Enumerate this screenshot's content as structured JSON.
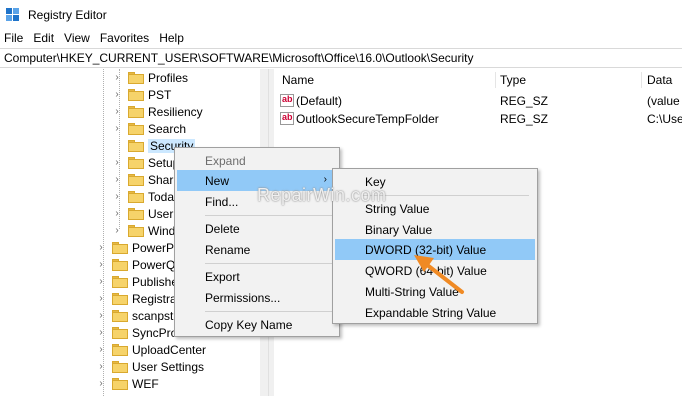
{
  "window": {
    "title": "Registry Editor"
  },
  "menu": [
    "File",
    "Edit",
    "View",
    "Favorites",
    "Help"
  ],
  "address": "Computer\\HKEY_CURRENT_USER\\SOFTWARE\\Microsoft\\Office\\16.0\\Outlook\\Security",
  "tree": {
    "items": [
      {
        "label": "Profiles"
      },
      {
        "label": "PST"
      },
      {
        "label": "Resiliency"
      },
      {
        "label": "Search"
      },
      {
        "label": "Security",
        "selected": true
      },
      {
        "label": "Setup"
      },
      {
        "label": "Sharin"
      },
      {
        "label": "Today"
      },
      {
        "label": "UserIn"
      },
      {
        "label": "Windo"
      },
      {
        "label": "PowerPo"
      },
      {
        "label": "PowerQu"
      },
      {
        "label": "Publisher"
      },
      {
        "label": "Registrati"
      },
      {
        "label": "scanpst"
      },
      {
        "label": "SyncProc"
      },
      {
        "label": "UploadCenter"
      },
      {
        "label": "User Settings"
      },
      {
        "label": "WEF"
      }
    ]
  },
  "list": {
    "columns": [
      "Name",
      "Type",
      "Data"
    ],
    "rows": [
      {
        "name": "(Default)",
        "type": "REG_SZ",
        "data": "(value"
      },
      {
        "name": "OutlookSecureTempFolder",
        "type": "REG_SZ",
        "data": "C:\\Use"
      }
    ]
  },
  "context_menu": {
    "items": [
      "Expand",
      "New",
      "Find...",
      "Delete",
      "Rename",
      "Export",
      "Permissions...",
      "Copy Key Name"
    ]
  },
  "submenu": {
    "items": [
      "Key",
      "String Value",
      "Binary Value",
      "DWORD (32-bit) Value",
      "QWORD (64-bit) Value",
      "Multi-String Value",
      "Expandable String Value"
    ]
  },
  "watermark": "RepairWin.com",
  "colors": {
    "highlight": "#91c9f7",
    "menu_bg": "#f2f2f2",
    "arrow": "#f08a24",
    "folder": "#f6d36a"
  }
}
